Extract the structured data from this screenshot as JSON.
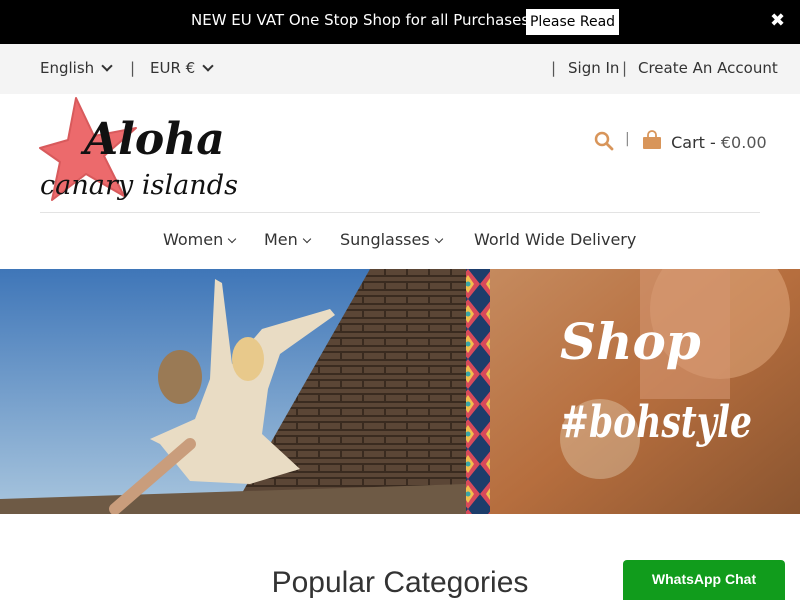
{
  "announcement": {
    "message": "NEW EU VAT One Stop Shop for all Purchases",
    "button_label": "Please Read",
    "close_glyph": "✖"
  },
  "topbar": {
    "language": "English",
    "currency": "EUR €",
    "sign_in": "Sign In",
    "create_account": "Create An Account",
    "separator": "|"
  },
  "header": {
    "logo_text_line1": "Aloha",
    "logo_text_line2": "canary islands",
    "cart_label": "Cart -",
    "cart_amount": "€0.00",
    "search_icon": "search-icon",
    "cart_icon": "shopping-bag-icon"
  },
  "nav": {
    "items": [
      {
        "label": "Women",
        "has_dropdown": true
      },
      {
        "label": "Men",
        "has_dropdown": true
      },
      {
        "label": "Sunglasses",
        "has_dropdown": true
      },
      {
        "label": "World Wide Delivery",
        "has_dropdown": false
      }
    ]
  },
  "hero": {
    "script_line1": "Shop",
    "script_line2": "#bohstyle"
  },
  "main": {
    "section_title": "Popular Categories"
  },
  "whatsapp": {
    "label": "WhatsApp Chat"
  },
  "colors": {
    "accent": "#d8955a",
    "logo_star": "#ec6a6c",
    "whatsapp_green": "#119c1c"
  }
}
